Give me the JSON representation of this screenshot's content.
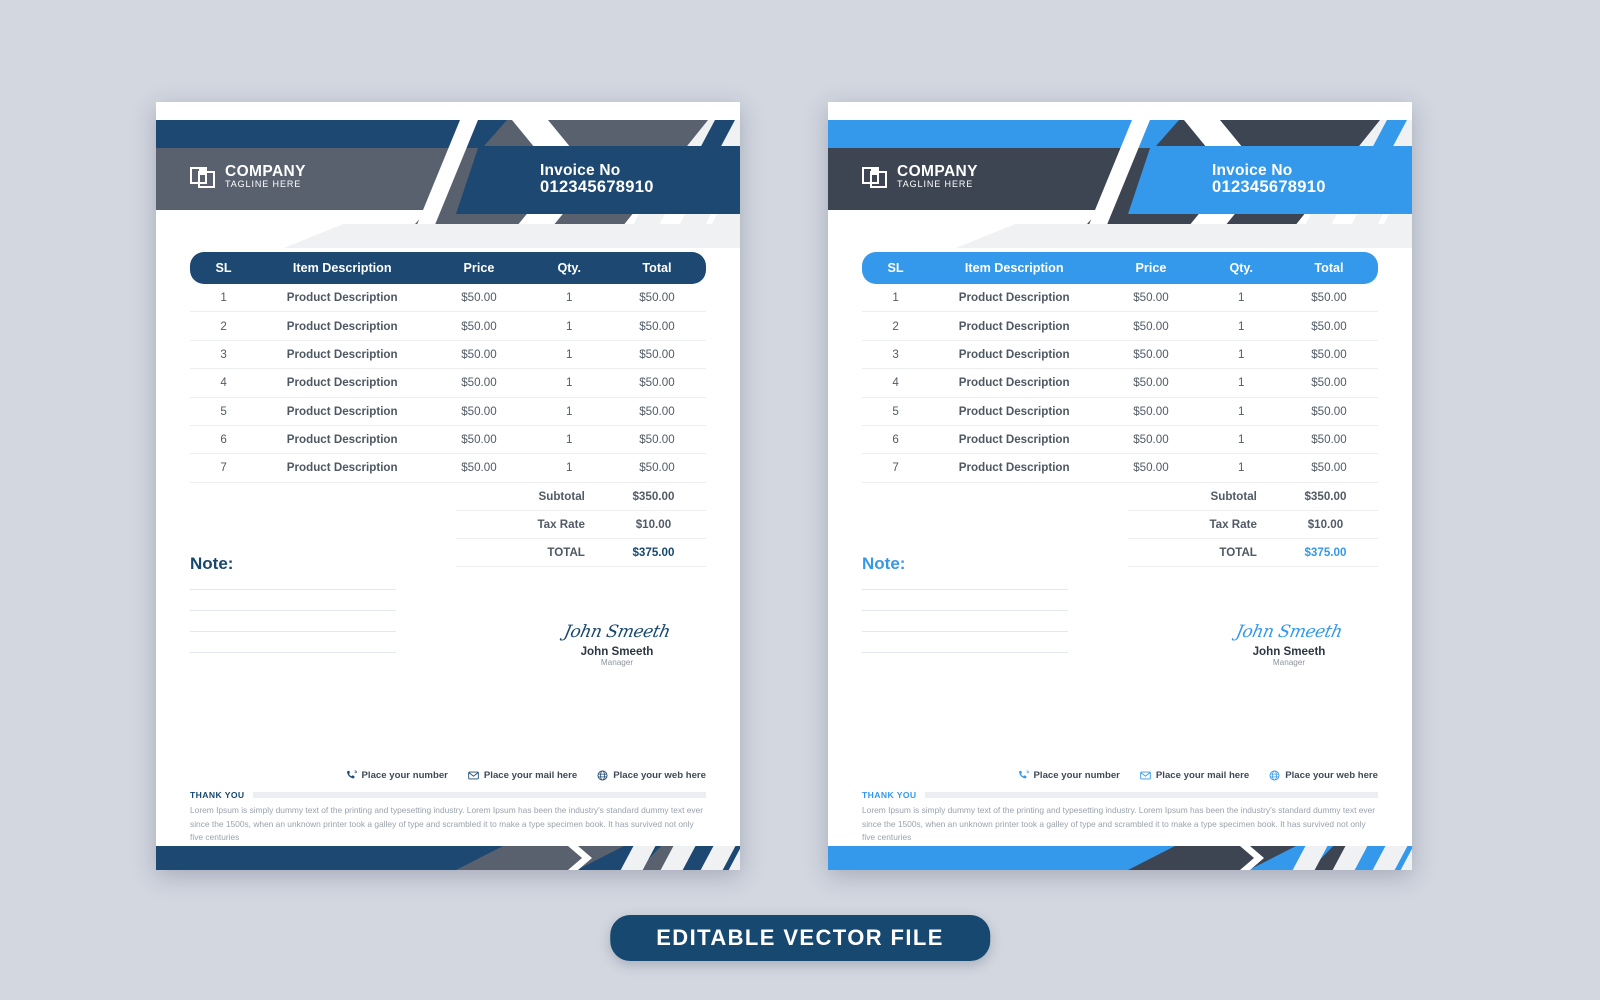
{
  "canvas": {
    "background": "#d3d7e0"
  },
  "banner": {
    "label": "EDITABLE VECTOR  FILE",
    "color": "#17486f"
  },
  "variants": [
    {
      "id": "dark",
      "accent": "#1d4871",
      "slab": "#59616f",
      "accent_text": "#17486f",
      "header": {
        "logo_name": "COMPANY",
        "logo_tagline": "TAGLINE HERE",
        "logo_icon": "overlapping-squares-icon",
        "invoice_label": "Invoice No",
        "invoice_number": "012345678910"
      },
      "table": {
        "columns": [
          "SL",
          "Item Description",
          "Price",
          "Qty.",
          "Total"
        ],
        "rows": [
          [
            "1",
            "Product Description",
            "$50.00",
            "1",
            "$50.00"
          ],
          [
            "2",
            "Product Description",
            "$50.00",
            "1",
            "$50.00"
          ],
          [
            "3",
            "Product Description",
            "$50.00",
            "1",
            "$50.00"
          ],
          [
            "4",
            "Product Description",
            "$50.00",
            "1",
            "$50.00"
          ],
          [
            "5",
            "Product Description",
            "$50.00",
            "1",
            "$50.00"
          ],
          [
            "6",
            "Product Description",
            "$50.00",
            "1",
            "$50.00"
          ],
          [
            "7",
            "Product Description",
            "$50.00",
            "1",
            "$50.00"
          ]
        ]
      },
      "totals": [
        {
          "label": "Subtotal",
          "value": "$350.00"
        },
        {
          "label": "Tax Rate",
          "value": "$10.00"
        },
        {
          "label": "TOTAL",
          "value": "$375.00"
        }
      ],
      "note": {
        "title": "Note:",
        "line_count": 4
      },
      "signature": {
        "script": "John Smeeth",
        "name": "John Smeeth",
        "role": "Manager"
      },
      "contacts": [
        {
          "icon": "phone-icon",
          "label": "Place your number"
        },
        {
          "icon": "mail-icon",
          "label": "Place your mail here"
        },
        {
          "icon": "globe-icon",
          "label": "Place your web here"
        }
      ],
      "footer": {
        "thank_you": "THANK YOU",
        "text": "Lorem Ipsum is simply dummy text of the printing and typesetting industry. Lorem Ipsum has been the industry's standard dummy text ever since the 1500s, when an unknown printer took a galley of type and scrambled it to make a type specimen book. It has survived not only five centuries"
      }
    },
    {
      "id": "blue",
      "accent": "#3498eb",
      "slab": "#3d4452",
      "accent_text": "#3498eb",
      "header": {
        "logo_name": "COMPANY",
        "logo_tagline": "TAGLINE HERE",
        "logo_icon": "overlapping-squares-icon",
        "invoice_label": "Invoice No",
        "invoice_number": "012345678910"
      },
      "table": {
        "columns": [
          "SL",
          "Item Description",
          "Price",
          "Qty.",
          "Total"
        ],
        "rows": [
          [
            "1",
            "Product Description",
            "$50.00",
            "1",
            "$50.00"
          ],
          [
            "2",
            "Product Description",
            "$50.00",
            "1",
            "$50.00"
          ],
          [
            "3",
            "Product Description",
            "$50.00",
            "1",
            "$50.00"
          ],
          [
            "4",
            "Product Description",
            "$50.00",
            "1",
            "$50.00"
          ],
          [
            "5",
            "Product Description",
            "$50.00",
            "1",
            "$50.00"
          ],
          [
            "6",
            "Product Description",
            "$50.00",
            "1",
            "$50.00"
          ],
          [
            "7",
            "Product Description",
            "$50.00",
            "1",
            "$50.00"
          ]
        ]
      },
      "totals": [
        {
          "label": "Subtotal",
          "value": "$350.00"
        },
        {
          "label": "Tax Rate",
          "value": "$10.00"
        },
        {
          "label": "TOTAL",
          "value": "$375.00"
        }
      ],
      "note": {
        "title": "Note:",
        "line_count": 4
      },
      "signature": {
        "script": "John Smeeth",
        "name": "John Smeeth",
        "role": "Manager"
      },
      "contacts": [
        {
          "icon": "phone-icon",
          "label": "Place your number"
        },
        {
          "icon": "mail-icon",
          "label": "Place your mail here"
        },
        {
          "icon": "globe-icon",
          "label": "Place your web here"
        }
      ],
      "footer": {
        "thank_you": "THANK YOU",
        "text": "Lorem Ipsum is simply dummy text of the printing and typesetting industry. Lorem Ipsum has been the industry's standard dummy text ever since the 1500s, when an unknown printer took a galley of type and scrambled it to make a type specimen book. It has survived not only five centuries"
      }
    }
  ]
}
